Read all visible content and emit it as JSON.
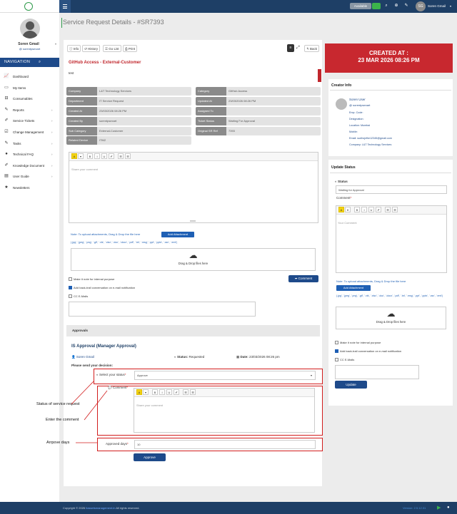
{
  "header": {
    "available": "Available",
    "user": "Soren Gmail",
    "initials": "SG"
  },
  "sidebar": {
    "name": "Soren Gmail",
    "handle": "@ sorentpsexart",
    "nav_title": "NAVIGATION",
    "items": [
      {
        "label": "Dashboard",
        "icon": "chart-line-icon"
      },
      {
        "label": "My Items",
        "icon": "items-icon"
      },
      {
        "label": "Consumables",
        "icon": "consumables-icon"
      },
      {
        "label": "Reports",
        "icon": "reports-icon",
        "chev": true
      },
      {
        "label": "Service Tickets",
        "icon": "ticket-icon",
        "chev": true
      },
      {
        "label": "Change Management",
        "icon": "change-icon",
        "chev": true
      },
      {
        "label": "Tasks",
        "icon": "tasks-icon",
        "chev": true
      },
      {
        "label": "Technical FAQ",
        "icon": "faq-icon",
        "chev": true
      },
      {
        "label": "Knowledge Document",
        "icon": "document-icon",
        "chev": true
      },
      {
        "label": "User Guide",
        "icon": "guide-icon",
        "chev": true
      },
      {
        "label": "Newsletters",
        "icon": "star-icon"
      }
    ]
  },
  "page": {
    "title": "Service Request Details - #SR7393"
  },
  "toolbar": {
    "info": "Info",
    "history": "History",
    "golist": "Go List",
    "print": "Print",
    "back": "Back"
  },
  "request": {
    "title": "GitHub Access - External-Customer",
    "text": "test",
    "left": [
      {
        "label": "Company",
        "value": "L&T Technology Services"
      },
      {
        "label": "Department",
        "value": "IT Service Request"
      },
      {
        "label": "Created At",
        "value": "23/03/2026 08:26 PM"
      },
      {
        "label": "Created By",
        "value": "sorentpsexart"
      },
      {
        "label": "Sub Category",
        "value": "External-Customer"
      },
      {
        "label": "Related Device",
        "value": "ITM2"
      }
    ],
    "right": [
      {
        "label": "Category",
        "value": "GitHub Access"
      },
      {
        "label": "Updated At",
        "value": "23/03/2026 08:26 PM"
      },
      {
        "label": "Assigned To",
        "value": ""
      },
      {
        "label": "Ticket Status",
        "value": "Waiting For Approval"
      },
      {
        "label": "Original SR Ref",
        "value": "7393"
      }
    ]
  },
  "comment": {
    "placeholder": "Share your comment",
    "note": "Note: To upload attachments, Drag & Drop the file here",
    "add": "Add Attachment",
    "types": "(.jpg', '.jpeg', '.png', '.gif', '.xls', '.xlsx', '.doc', '.docx', '.pdf', '.txt', '.msg', '.ppt', '.pptx', '.csv', '.eml')",
    "drop": "Drag & Drop files here",
    "internal": "Make it note for internal purpose",
    "addback": "Add back-trail conversation on e-mail notification",
    "cc": "CC E-Mails",
    "submit": "Comment"
  },
  "approvals": {
    "heading": "Approvals",
    "title": "IS Approval (Manager Approval)",
    "approver": "Soren Gmail",
    "status_label": "Status:",
    "status": "Requested",
    "date_label": "Date:",
    "date": "23/03/2026 08:26 pm",
    "decision": "Please send your decision:",
    "select_label": "Select your status",
    "select_value": "Approve",
    "comment_label": "Comment",
    "comment_ph": "Share your comment",
    "days_label": "Approved days",
    "days_value": "10",
    "button": "Approve"
  },
  "annotations": {
    "status": "Status of service request",
    "comment": "Enter the comment",
    "days": "Arrpove days"
  },
  "created": {
    "label": "CREATED AT :",
    "value": "23 MAR 2026 08:26 PM"
  },
  "creator": {
    "heading": "Creator Info",
    "name": "Soren User",
    "handle": "@ sorentpsexart",
    "empcode": "Emp. Code:",
    "designation": "Designation:",
    "location": "Location: Mumbai",
    "mobile": "Mobile:",
    "email": "Email: sudhsjnfhe12345@gmail.com",
    "company": "Company: L&T Technology Services"
  },
  "update": {
    "heading": "Update Status",
    "status_label": "Status",
    "status_value": "Waiting for Approval",
    "comment_label": "Comment",
    "comment_ph": "Your Comment",
    "note": "Note: To upload attachments, Drag & Drop the file here",
    "add": "Add Attachment",
    "types": "(.jpg', '.jpeg', '.png', '.gif', '.xls', '.xlsx', '.doc', '.docx', '.pdf', '.txt', '.msg', '.ppt', '.pptx', '.csv', '.eml')",
    "drop": "Drag & Drop files here",
    "internal": "Make it note for internal purpose",
    "addback": "Add back-trail conversation on e-mail notification",
    "cc": "CC E-Mails",
    "button": "Update"
  },
  "footer": {
    "copyright": "Copyright © 2026",
    "link": "itassetsmanagement.in",
    "rights": "All rights reserved.",
    "version": "Version: 2.5.12.31"
  }
}
